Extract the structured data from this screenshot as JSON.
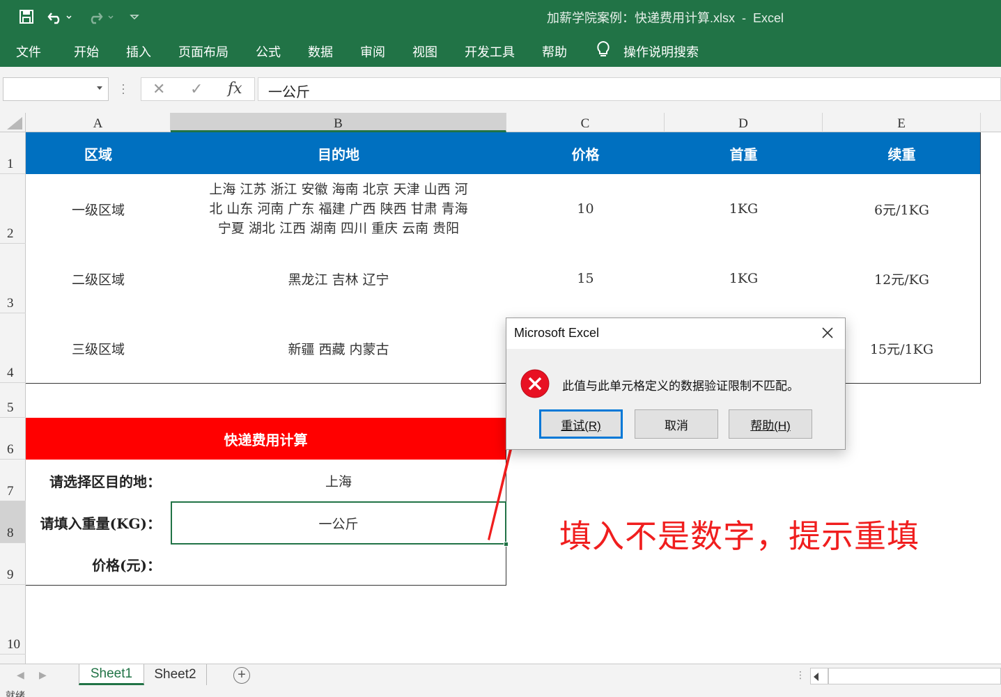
{
  "app": {
    "title": "加薪学院案例：快递费用计算.xlsx  -  Excel"
  },
  "ribbon": {
    "tabs": [
      "文件",
      "开始",
      "插入",
      "页面布局",
      "公式",
      "数据",
      "审阅",
      "视图",
      "开发工具",
      "帮助"
    ],
    "search_label": "操作说明搜索"
  },
  "formula_bar": {
    "name_box": "",
    "cancel_glyph": "✕",
    "enter_glyph": "✓",
    "fx_label": "fx",
    "content": "一公斤"
  },
  "columns": [
    "A",
    "B",
    "C",
    "D",
    "E"
  ],
  "rows": [
    "1",
    "2",
    "3",
    "4",
    "5",
    "6",
    "7",
    "8",
    "9",
    "10"
  ],
  "sheet": {
    "header": [
      "区域",
      "目的地",
      "价格",
      "首重",
      "续重"
    ],
    "regions": [
      {
        "name": "一级区域",
        "dest_lines": [
          "上海 江苏 浙江 安徽 海南 北京 天津 山西 河",
          "北 山东 河南 广东 福建 广西 陕西 甘肃 青海",
          "宁夏 湖北 江西 湖南 四川 重庆 云南 贵阳"
        ],
        "price": "10",
        "first": "1KG",
        "extra": "6元/1KG"
      },
      {
        "name": "二级区域",
        "dest_lines": [
          "黑龙江 吉林 辽宁"
        ],
        "price": "15",
        "first": "1KG",
        "extra": "12元/KG"
      },
      {
        "name": "三级区域",
        "dest_lines": [
          "新疆 西藏 内蒙古"
        ],
        "price": "",
        "first": "",
        "extra": "15元/1KG"
      }
    ],
    "calc": {
      "title": "快递费用计算",
      "dest_label": "请选择区目的地：",
      "dest_value": "上海",
      "weight_label": "请填入重量(KG)：",
      "weight_value": "一公斤",
      "price_label": "价格(元)：",
      "price_value": ""
    }
  },
  "dialog": {
    "title": "Microsoft Excel",
    "message": "此值与此单元格定义的数据验证限制不匹配。",
    "buttons": [
      "重试(R)",
      "取消",
      "帮助(H)"
    ]
  },
  "annotation": "填入不是数字，提示重填",
  "sheet_tabs": [
    "Sheet1",
    "Sheet2"
  ],
  "add_sheet_glyph": "+",
  "status": "就绪",
  "colors": {
    "excel_green": "#217346",
    "table_header_blue": "#0070c0",
    "calc_title_red": "#ff0000",
    "annotation_red": "#f01e1e"
  }
}
